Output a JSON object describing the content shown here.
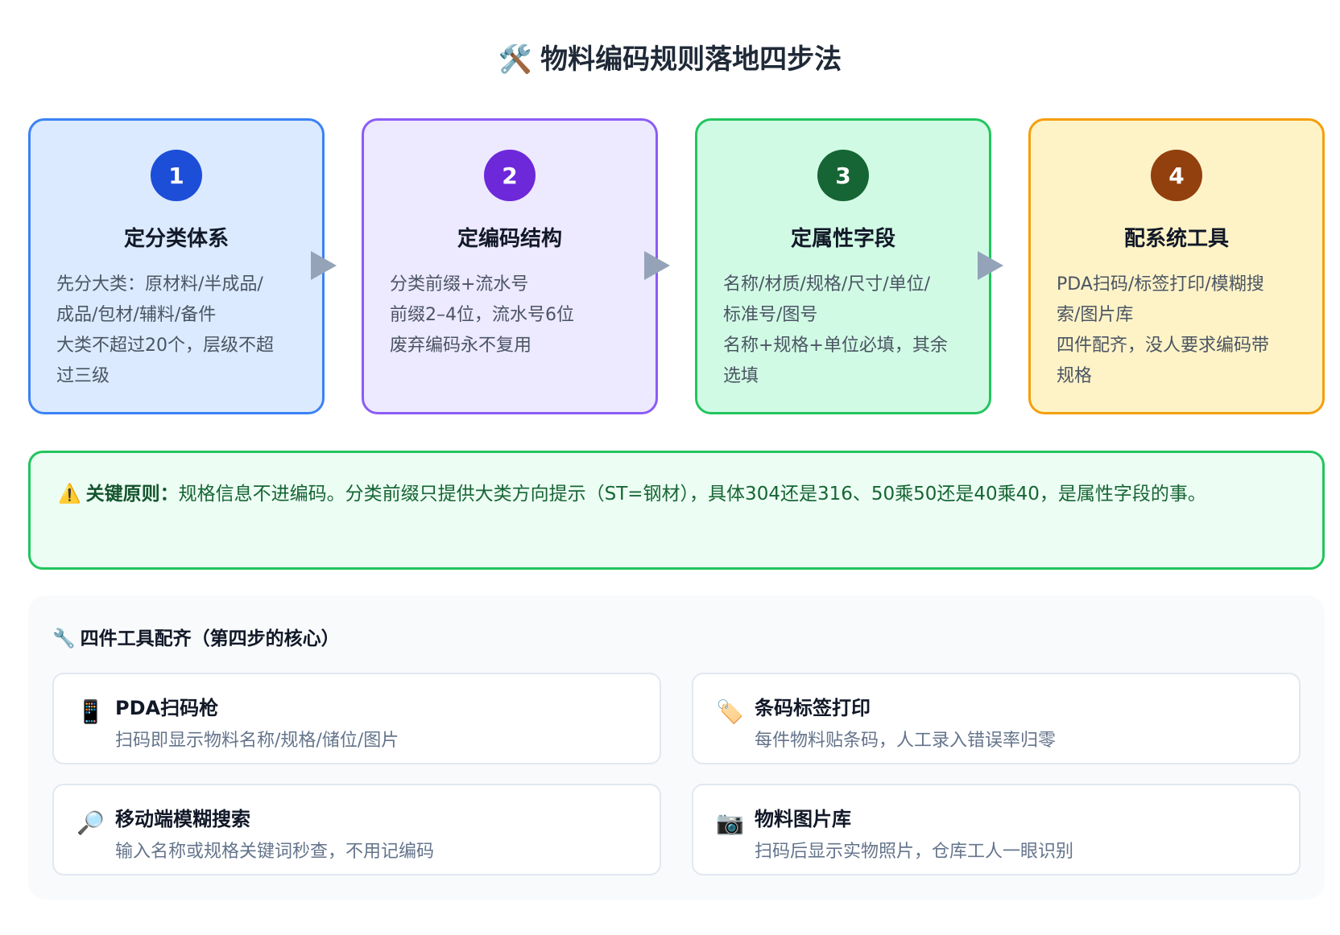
{
  "title": {
    "icon": "🛠️",
    "text": "物料编码规则落地四步法"
  },
  "steps": [
    {
      "number": "1",
      "title": "定分类体系",
      "lines": [
        "先分大类：原材料/半成品/",
        "成品/包材/辅料/备件",
        "大类不超过20个，层级不超",
        "过三级"
      ],
      "border": "#3b82f6",
      "bg": "#dbeafe",
      "badge": "#1d4ed8"
    },
    {
      "number": "2",
      "title": "定编码结构",
      "lines": [
        "分类前缀+流水号",
        "前缀2–4位，流水号6位",
        "废弃编码永不复用"
      ],
      "border": "#8b5cf6",
      "bg": "#ede9fe",
      "badge": "#6d28d9"
    },
    {
      "number": "3",
      "title": "定属性字段",
      "lines": [
        "名称/材质/规格/尺寸/单位/",
        "标准号/图号",
        "名称+规格+单位必填，其余",
        "选填"
      ],
      "border": "#22c55e",
      "bg": "#d1fae5",
      "badge": "#166534"
    },
    {
      "number": "4",
      "title": "配系统工具",
      "lines": [
        "PDA扫码/标签打印/模糊搜",
        "索/图片库",
        "四件配齐，没人要求编码带",
        "规格"
      ],
      "border": "#f59e0b",
      "bg": "#fef3c7",
      "badge": "#92400e"
    }
  ],
  "principle": {
    "icon": "⚠️",
    "label": "关键原则：",
    "text": "规格信息不进编码。分类前缀只提供大类方向提示（ST=钢材），具体304还是316、50乘50还是40乘40，是属性字段的事。"
  },
  "tools": {
    "icon": "🔧",
    "title": "四件工具配齐（第四步的核心）",
    "items": [
      {
        "icon": "📱",
        "name": "PDA扫码枪",
        "desc": "扫码即显示物料名称/规格/储位/图片"
      },
      {
        "icon": "🏷️",
        "name": "条码标签打印",
        "desc": "每件物料贴条码，人工录入错误率归零"
      },
      {
        "icon": "🔎",
        "name": "移动端模糊搜索",
        "desc": "输入名称或规格关键词秒查，不用记编码"
      },
      {
        "icon": "📷",
        "name": "物料图片库",
        "desc": "扫码后显示实物照片，仓库工人一眼识别"
      }
    ]
  }
}
